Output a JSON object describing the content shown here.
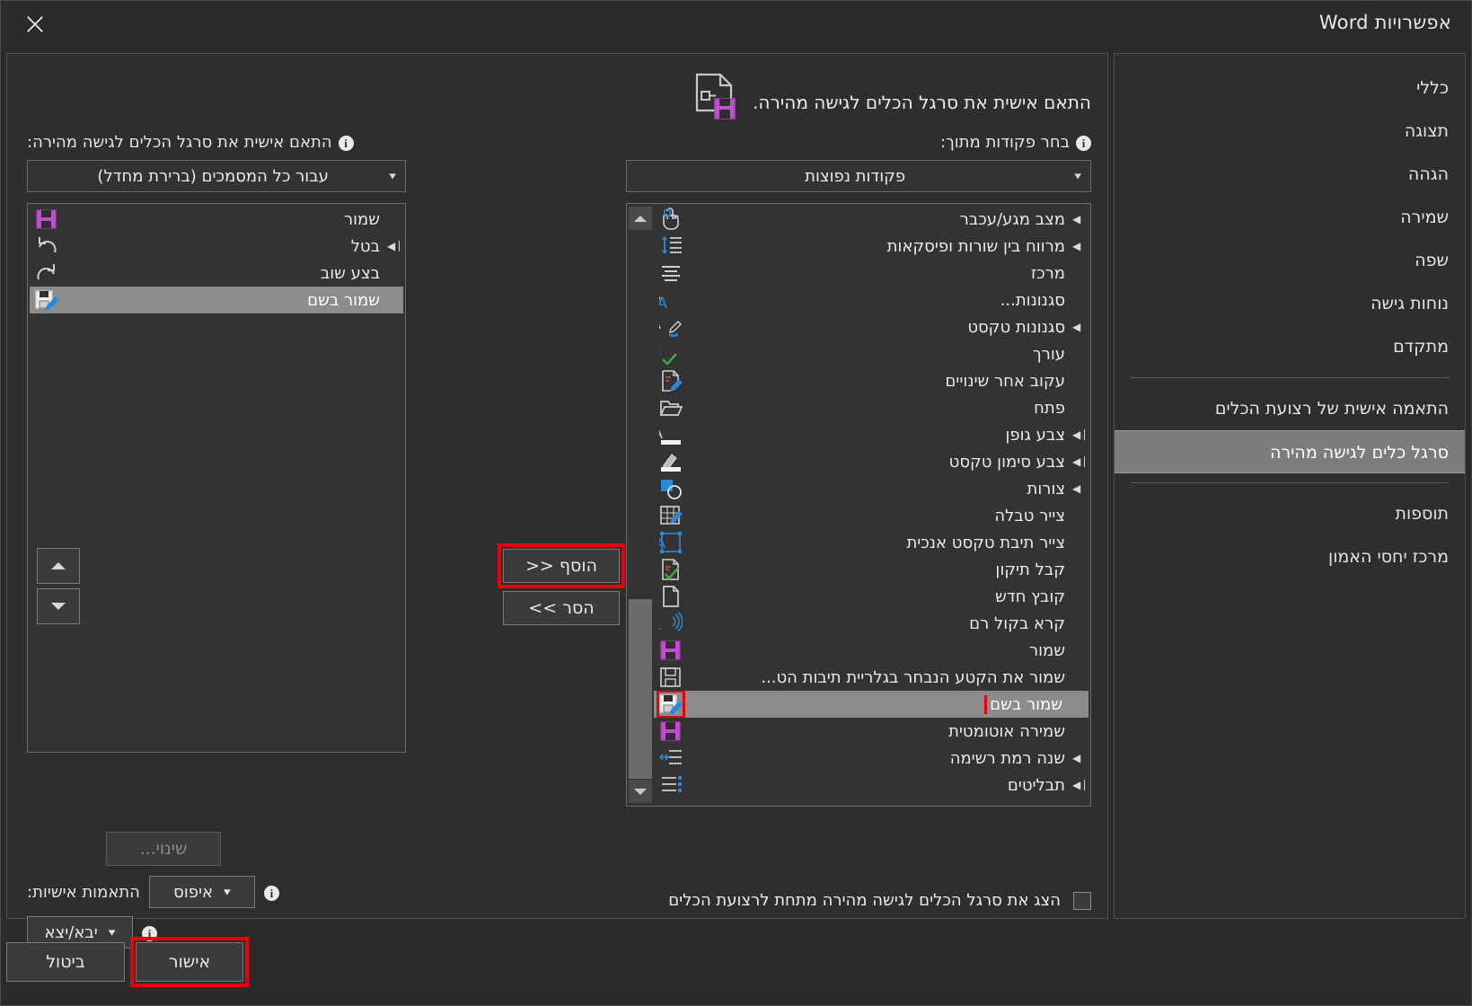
{
  "window": {
    "title": "אפשרויות Word",
    "close_icon": "close-icon"
  },
  "nav": {
    "items": [
      {
        "label": "כללי",
        "selected": false
      },
      {
        "label": "תצוגה",
        "selected": false
      },
      {
        "label": "הגהה",
        "selected": false
      },
      {
        "label": "שמירה",
        "selected": false
      },
      {
        "label": "שפה",
        "selected": false
      },
      {
        "label": "נוחות גישה",
        "selected": false
      },
      {
        "label": "מתקדם",
        "selected": false
      },
      {
        "separator": true
      },
      {
        "label": "התאמה אישית של רצועת הכלים",
        "selected": false
      },
      {
        "label": "סרגל כלים לגישה מהירה",
        "selected": true
      },
      {
        "separator": true
      },
      {
        "label": "תוספות",
        "selected": false
      },
      {
        "label": "מרכז יחסי האמון",
        "selected": false
      }
    ]
  },
  "pane": {
    "heading": "התאם אישית את סרגל הכלים לגישה מהירה.",
    "heading_icon": "document-save-icon",
    "source_label_pre": "ב",
    "source_label_rest": "חר פקודות מתוך:",
    "source_label_full": "בחר פקודות מתוך:",
    "target_label_pre": "הת",
    "target_label_rest": "אם אישית את סרגל הכלים לגישה מהירה:",
    "target_label_full": "התאם אישית את סרגל הכלים לגישה מהירה:",
    "info_glyph": "i",
    "source_combo_value": "פקודות נפוצות",
    "target_combo_value": "עבור כל המסמכים (ברירת מחדל)",
    "caret_glyph": "▼"
  },
  "commands_list": {
    "name": "available-commands-list",
    "items": [
      {
        "label": "מצב מגע/עכבר",
        "icon": "touch-mouse-mode-icon",
        "submenu": true
      },
      {
        "label": "מרווח בין שורות ופיסקאות",
        "icon": "line-paragraph-spacing-icon",
        "submenu": true
      },
      {
        "label": "מרכז",
        "icon": "align-center-icon",
        "submenu": false
      },
      {
        "label": "סגנונות...",
        "icon": "styles-icon",
        "submenu": false
      },
      {
        "label": "סגנונות טקסט",
        "icon": "text-styles-icon",
        "submenu": true
      },
      {
        "label": "עורך",
        "icon": "editor-spellcheck-icon",
        "submenu": false
      },
      {
        "label": "עקוב אחר שינויים",
        "icon": "track-changes-icon",
        "submenu": false
      },
      {
        "label": "פתח",
        "icon": "open-folder-icon",
        "submenu": false
      },
      {
        "label": "צבע גופן",
        "icon": "font-color-icon",
        "submenu": "split"
      },
      {
        "label": "צבע סימון טקסט",
        "icon": "text-highlight-color-icon",
        "submenu": "split"
      },
      {
        "label": "צורות",
        "icon": "shapes-icon",
        "submenu": true
      },
      {
        "label": "צייר טבלה",
        "icon": "draw-table-icon",
        "submenu": false
      },
      {
        "label": "צייר תיבת טקסט אנכית",
        "icon": "vertical-text-box-icon",
        "submenu": false
      },
      {
        "label": "קבל תיקון",
        "icon": "accept-revision-icon",
        "submenu": false
      },
      {
        "label": "קובץ חדש",
        "icon": "new-file-icon",
        "submenu": false
      },
      {
        "label": "קרא בקול רם",
        "icon": "read-aloud-icon",
        "submenu": false
      },
      {
        "label": "שמור",
        "icon": "save-icon",
        "submenu": false
      },
      {
        "label": "שמור את הקטע הנבחר בגלריית תיבות הט...",
        "icon": "save-selection-icon",
        "submenu": false
      },
      {
        "label": "שמור בשם",
        "icon": "save-as-icon",
        "submenu": false,
        "selected": true,
        "highlight": true
      },
      {
        "label": "שמירה אוטומטית",
        "icon": "autosave-icon",
        "submenu": false
      },
      {
        "label": "שנה רמת רשימה",
        "icon": "change-list-level-icon",
        "submenu": true
      },
      {
        "label": "תבליטים",
        "icon": "bullets-icon",
        "submenu": "split"
      }
    ]
  },
  "qat_list": {
    "name": "quick-access-toolbar-list",
    "items": [
      {
        "label": "שמור",
        "icon": "save-icon",
        "submenu": false
      },
      {
        "label": "בטל",
        "icon": "undo-icon",
        "submenu": "split"
      },
      {
        "label": "בצע שוב",
        "icon": "redo-icon",
        "submenu": false
      },
      {
        "label": "שמור בשם",
        "icon": "save-as-icon",
        "submenu": false,
        "selected": true
      }
    ]
  },
  "buttons": {
    "add": "הוסף << ",
    "add_text": "הוסף",
    "add_arrows": "<<",
    "remove_text": "הסר",
    "remove_arrows": ">>",
    "modify": "שינוי...",
    "move_up_icon": "move-up-icon",
    "move_down_icon": "move-down-icon",
    "ok": "אישור",
    "cancel": "ביטול"
  },
  "reset": {
    "label": "התאמות אישיות:",
    "button": "איפוס",
    "caret": "▼"
  },
  "import_export": {
    "button": "יבא/יצא",
    "caret": "▼"
  },
  "show_below_ribbon": {
    "label": "הצג את סרגל הכלים לגישה מהירה מתחת לרצועת הכלים",
    "checked": false
  },
  "colors": {
    "dialog_bg": "#2b2b2b",
    "panel_bg": "#2e2e2e",
    "list_bg": "#333333",
    "selection": "#8c8c8c",
    "nav_selection": "#7d7d7d",
    "highlight_red": "#e8000d",
    "accent_purple": "#c04fd0",
    "accent_blue": "#2b88d8",
    "text": "#eaeaea"
  }
}
